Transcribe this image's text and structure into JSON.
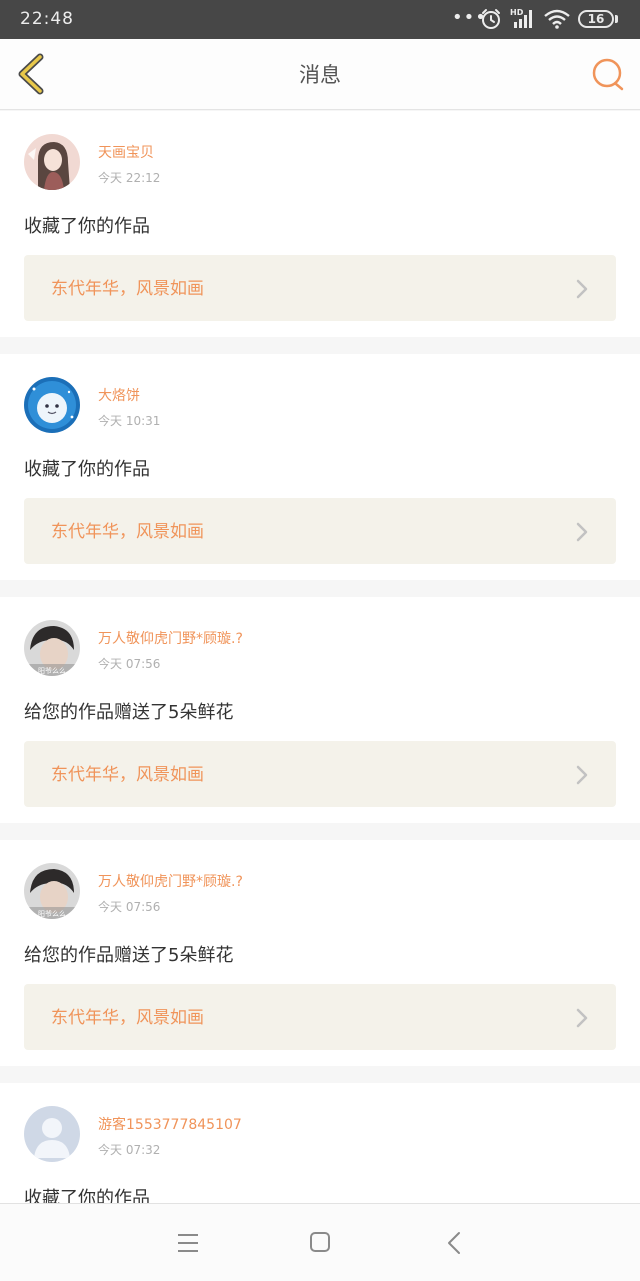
{
  "status_bar": {
    "time": "22:48",
    "dots": "•••",
    "battery": "16"
  },
  "header": {
    "title": "消息"
  },
  "messages": [
    {
      "username": "天画宝贝",
      "time": "今天 22:12",
      "action": "收藏了你的作品",
      "work_title": "东代年华，风景如画",
      "avatar_icon": "anime-girl-avatar"
    },
    {
      "username": "大烙饼",
      "time": "今天 10:31",
      "action": "收藏了你的作品",
      "work_title": "东代年华，风景如画",
      "avatar_icon": "snowman-avatar"
    },
    {
      "username": "万人敬仰虎门野*顾璇.?",
      "time": "今天 07:56",
      "action": "给您的作品赠送了5朵鲜花",
      "work_title": "东代年华，风景如画",
      "avatar_icon": "boy-photo-avatar",
      "avatar_caption": "阳爷么么"
    },
    {
      "username": "万人敬仰虎门野*顾璇.?",
      "time": "今天 07:56",
      "action": "给您的作品赠送了5朵鲜花",
      "work_title": "东代年华，风景如画",
      "avatar_icon": "boy-photo-avatar",
      "avatar_caption": "阳爷么么"
    },
    {
      "username": "游客1553777845107",
      "time": "今天 07:32",
      "action": "收藏了你的作品",
      "work_title": "",
      "avatar_icon": "default-user-avatar"
    }
  ],
  "colors": {
    "accent": "#f0945a",
    "back_arrow": "#e8c84a",
    "status_bar_bg": "#474747",
    "work_box_bg": "#f4f2ea"
  }
}
